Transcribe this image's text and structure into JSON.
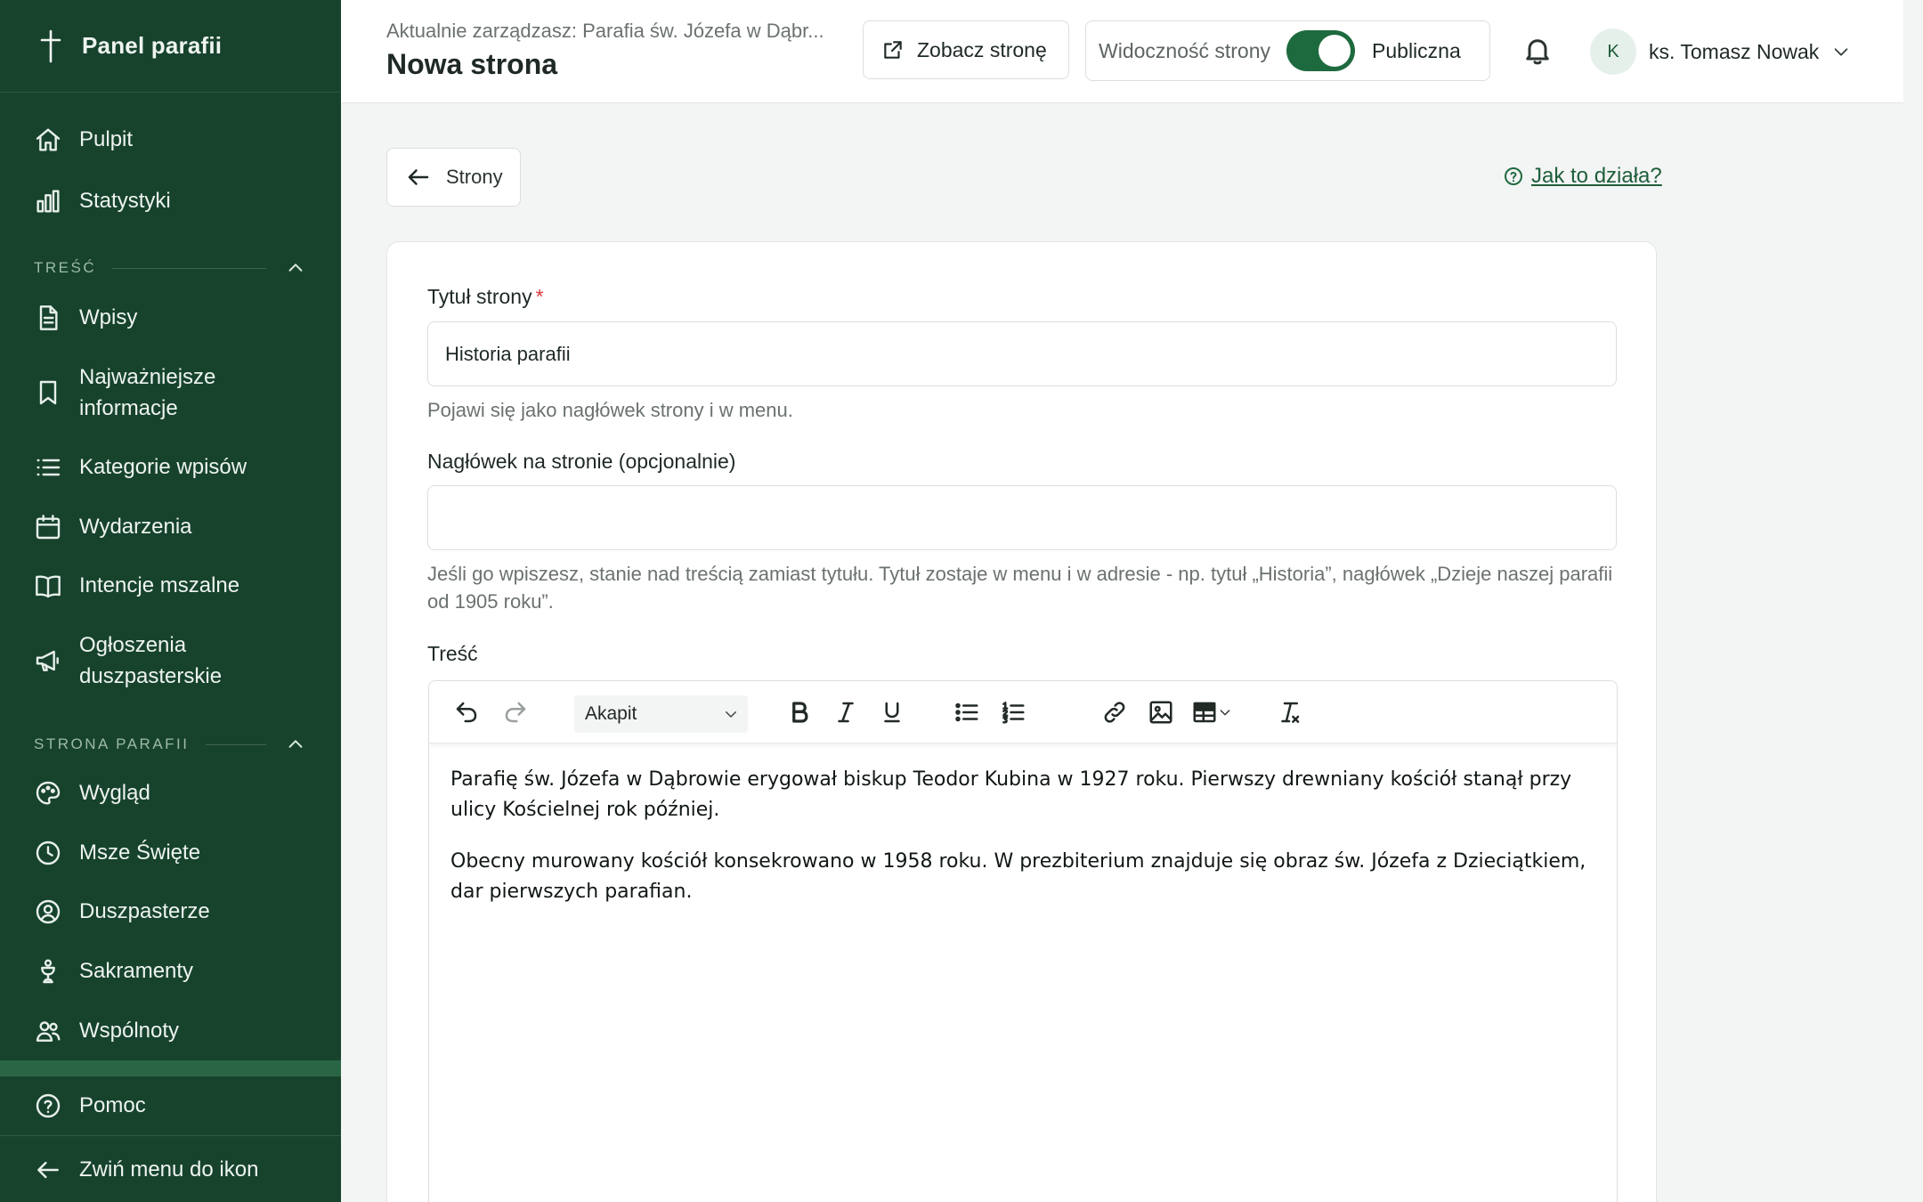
{
  "sidebar": {
    "brand": "Panel parafii",
    "items_top": [
      {
        "label": "Pulpit",
        "icon": "home-icon"
      },
      {
        "label": "Statystyki",
        "icon": "bar-chart-icon"
      }
    ],
    "section_content": "TREŚĆ",
    "items_content": [
      {
        "label": "Wpisy",
        "icon": "document-icon"
      },
      {
        "label": "Najważniejsze informacje",
        "icon": "bookmark-icon"
      },
      {
        "label": "Kategorie wpisów",
        "icon": "list-icon"
      },
      {
        "label": "Wydarzenia",
        "icon": "calendar-icon"
      },
      {
        "label": "Intencje mszalne",
        "icon": "book-icon"
      },
      {
        "label": "Ogłoszenia duszpasterskie",
        "icon": "megaphone-icon"
      }
    ],
    "section_site": "STRONA PARAFII",
    "items_site": [
      {
        "label": "Wygląd",
        "icon": "palette-icon"
      },
      {
        "label": "Msze Święte",
        "icon": "clock-icon"
      },
      {
        "label": "Duszpasterze",
        "icon": "user-circle-icon"
      },
      {
        "label": "Sakramenty",
        "icon": "chalice-icon"
      },
      {
        "label": "Wspólnoty",
        "icon": "users-icon"
      }
    ],
    "help": {
      "label": "Pomoc",
      "icon": "help-circle-icon"
    },
    "collapse": {
      "label": "Zwiń menu do ikon",
      "icon": "arrow-left-icon"
    }
  },
  "topbar": {
    "context": "Aktualnie zarządzasz: Parafia św. Józefa w Dąbr...",
    "title": "Nowa strona",
    "view_button": "Zobacz stronę",
    "visibility_label": "Widoczność strony",
    "visibility_state": "Publiczna",
    "visibility_on": true,
    "user_initial": "K",
    "user_name": "ks. Tomasz Nowak"
  },
  "content": {
    "back_button": "Strony",
    "help_link": "Jak to działa?",
    "title_label": "Tytuł strony",
    "title_required": "*",
    "title_value": "Historia parafii",
    "title_hint": "Pojawi się jako nagłówek strony i w menu.",
    "heading_label": "Nagłówek na stronie (opcjonalnie)",
    "heading_value": "",
    "heading_hint": "Jeśli go wpiszesz, stanie nad treścią zamiast tytułu. Tytuł zostaje w menu i w adresie - np. tytuł „Historia”, nagłówek „Dzieje naszej parafii od 1905 roku”.",
    "body_label": "Treść",
    "format_select": "Akapit",
    "paragraphs": [
      "Parafię św. Józefa w Dąbrowie erygował biskup Teodor Kubina w 1927 roku. Pierwszy drewniany kościół stanął przy ulicy Kościelnej rok później.",
      "Obecny murowany kościół konsekrowano w 1958 roku. W prezbiterium znajduje się obraz św. Józefa z Dzieciątkiem, dar pierwszych parafian."
    ]
  },
  "colors": {
    "sidebar_bg": "#17432d",
    "accent": "#1e6a3f",
    "required": "#d53c3c"
  }
}
